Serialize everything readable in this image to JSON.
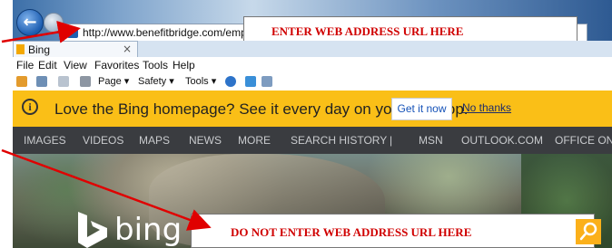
{
  "browser": {
    "url": "http://www.benefitbridge.com/employercode",
    "tab_label": "Bing",
    "tab_close": "×",
    "menu": [
      "File",
      "Edit",
      "View",
      "Favorites",
      "Tools",
      "Help"
    ],
    "command_bar": {
      "page": "Page ▾",
      "safety": "Safety ▾",
      "tools": "Tools ▾"
    }
  },
  "annotations": {
    "enter_url": "ENTER WEB ADDRESS URL HERE",
    "do_not_enter": "DO NOT ENTER WEB ADDRESS URL HERE"
  },
  "notification": {
    "message": "Love the Bing homepage? See it every day on your desktop.",
    "get_it_now": "Get it now",
    "no_thanks": "No thanks"
  },
  "bing_nav": [
    "IMAGES",
    "VIDEOS",
    "MAPS",
    "NEWS",
    "MORE",
    "SEARCH HISTORY",
    "|",
    "MSN",
    "OUTLOOK.COM",
    "OFFICE ONLI"
  ],
  "bing": {
    "logo_text": "bing"
  },
  "colors": {
    "annotation_red": "#d00000",
    "notice_yellow": "#fabf17",
    "nav_dark": "#3a3c40"
  }
}
